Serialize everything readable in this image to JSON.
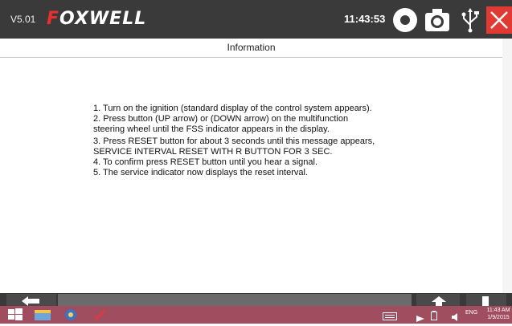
{
  "header": {
    "version": "V5.01",
    "brand": "FOXWELL",
    "brand_accent_color": "#e8312e",
    "time": "11:43:53",
    "icons": [
      "record-icon",
      "camera-icon",
      "usb-icon",
      "close-icon"
    ]
  },
  "page": {
    "title": "Information"
  },
  "content": {
    "paragraphs": [
      "1. Turn on the ignition (standard display of the control system appears).",
      "2. Press button (UP arrow) or (DOWN arrow) on the multifunction steering wheel until the FSS indicator appears in the display.",
      "3. Press RESET button for about 3 seconds until this message appears, SERVICE INTERVAL RESET WITH R BUTTON FOR 3 SEC.",
      "4. To confirm press RESET button until you hear a signal.",
      "5. The service indicator now displays the reset interval."
    ]
  },
  "navbar": {
    "icons": [
      "back-arrow-icon",
      "up-arrow-icon",
      "menu-icon"
    ]
  },
  "taskbar": {
    "color": "#a04d60",
    "language": "ENG",
    "time": "11:43 AM",
    "date": "1/9/2015",
    "icons": [
      "windows-start-icon",
      "explorer-icon",
      "settings-app-icon",
      "pen-app-icon",
      "keyboard-icon",
      "network-icon",
      "battery-icon",
      "volume-icon"
    ]
  }
}
